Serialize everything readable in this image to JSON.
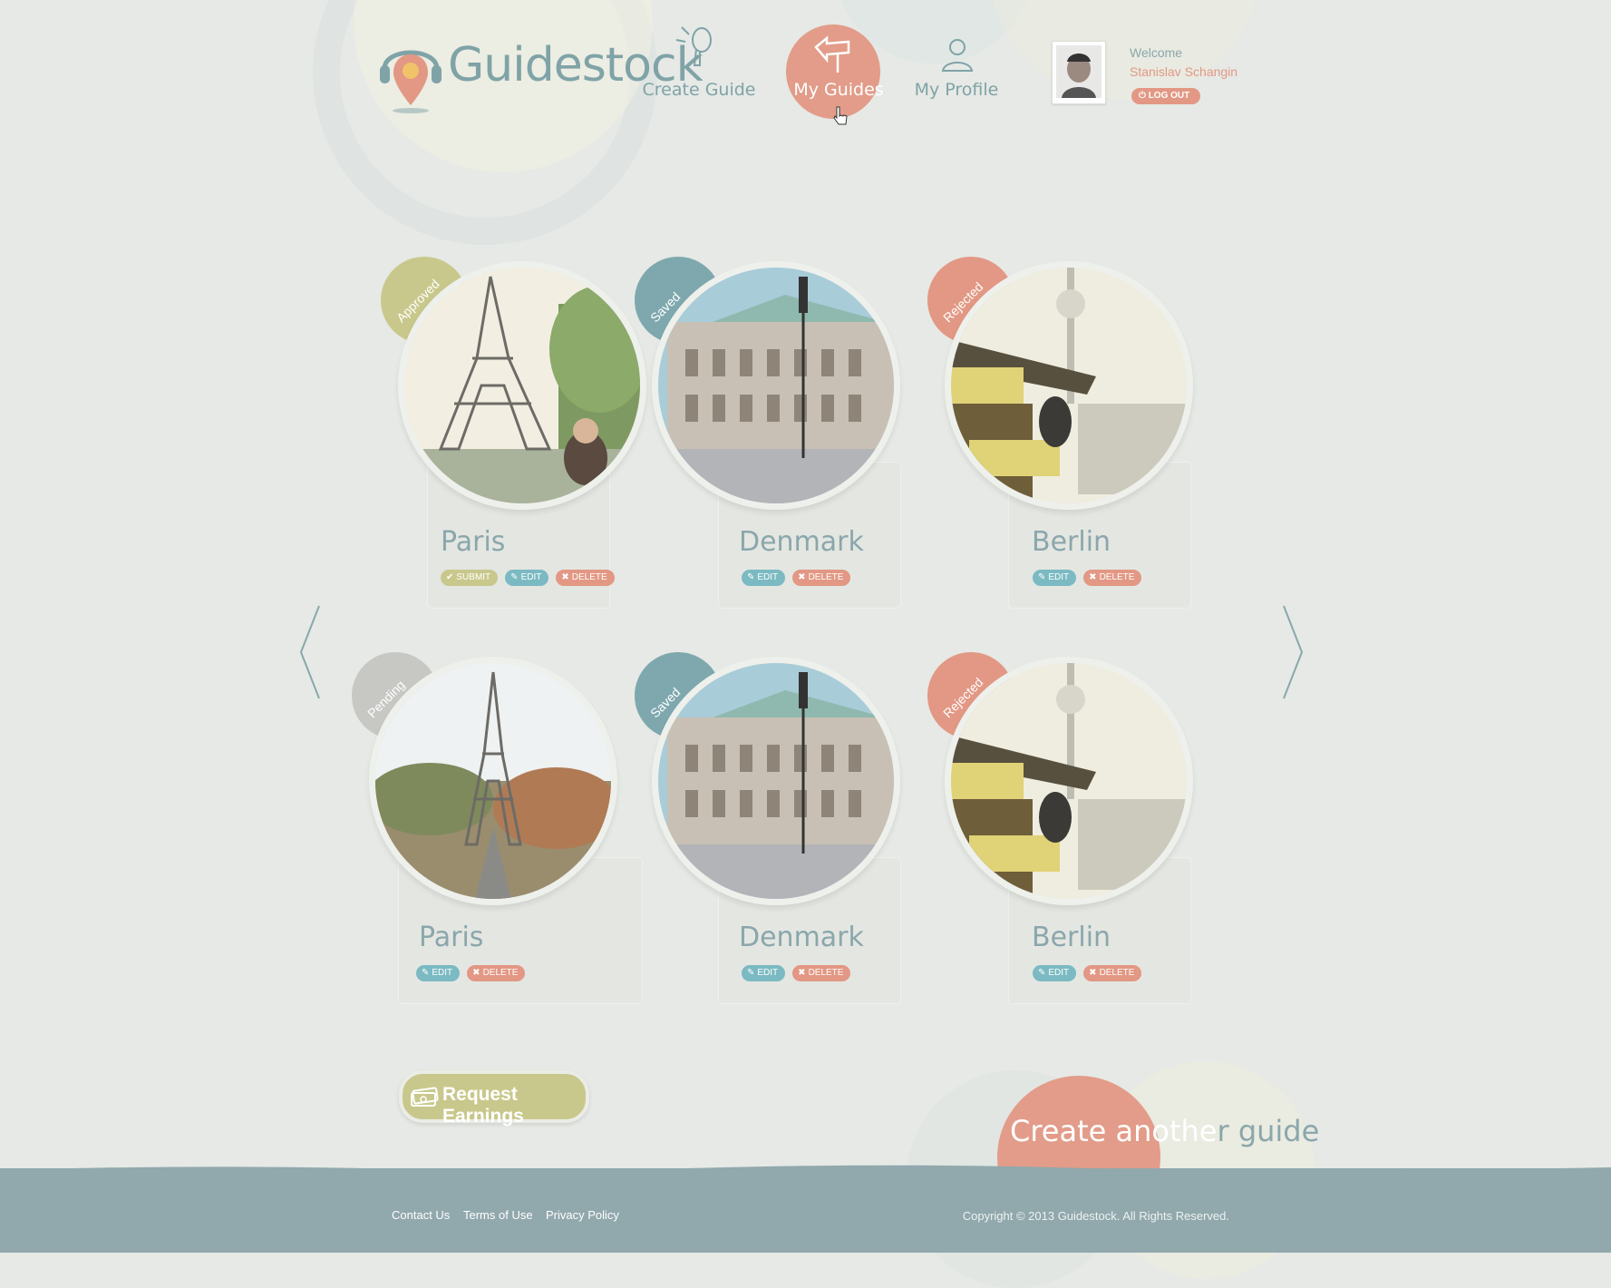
{
  "header": {
    "logo_text": "Guidestock",
    "nav": [
      {
        "label": "Create Guide",
        "icon": "microphone-icon"
      },
      {
        "label": "My Guides",
        "icon": "signpost-icon",
        "active": true
      },
      {
        "label": "My Profile",
        "icon": "user-icon"
      }
    ],
    "welcome": "Welcome",
    "username": "Stanislav Schangin",
    "logout_label": "LOG OUT"
  },
  "guides": [
    {
      "title": "Paris",
      "status": "Approved",
      "status_color": "#c9c88c",
      "actions": [
        "SUBMIT",
        "EDIT",
        "DELETE"
      ],
      "photo": "eiffel-tower-photo"
    },
    {
      "title": "Denmark",
      "status": "Saved",
      "status_color": "#7ea8ae",
      "actions": [
        "EDIT",
        "DELETE"
      ],
      "photo": "opera-building-photo"
    },
    {
      "title": "Berlin",
      "status": "Rejected",
      "status_color": "#e29884",
      "actions": [
        "EDIT",
        "DELETE"
      ],
      "photo": "tv-tower-photo"
    },
    {
      "title": "Paris",
      "status": "Pending",
      "status_color": "#c7c7c4",
      "actions": [
        "EDIT",
        "DELETE"
      ],
      "photo": "eiffel-tower-park-photo"
    },
    {
      "title": "Denmark",
      "status": "Saved",
      "status_color": "#7ea8ae",
      "actions": [
        "EDIT",
        "DELETE"
      ],
      "photo": "opera-building-photo"
    },
    {
      "title": "Berlin",
      "status": "Rejected",
      "status_color": "#e29884",
      "actions": [
        "EDIT",
        "DELETE"
      ],
      "photo": "tv-tower-photo"
    }
  ],
  "request_earnings_label": "Request Earnings",
  "create_another": {
    "part1": "Create anothe",
    "part2": "r guide"
  },
  "footer": {
    "links": [
      "Contact Us",
      "Terms of Use",
      "Privacy Policy"
    ],
    "copyright": "Copyright © 2013 Guidestock. All Rights Reserved."
  },
  "colors": {
    "accent": "#e29884",
    "teal": "#7bbac2",
    "olive": "#c9c88c",
    "footer": "#91a8ad"
  }
}
